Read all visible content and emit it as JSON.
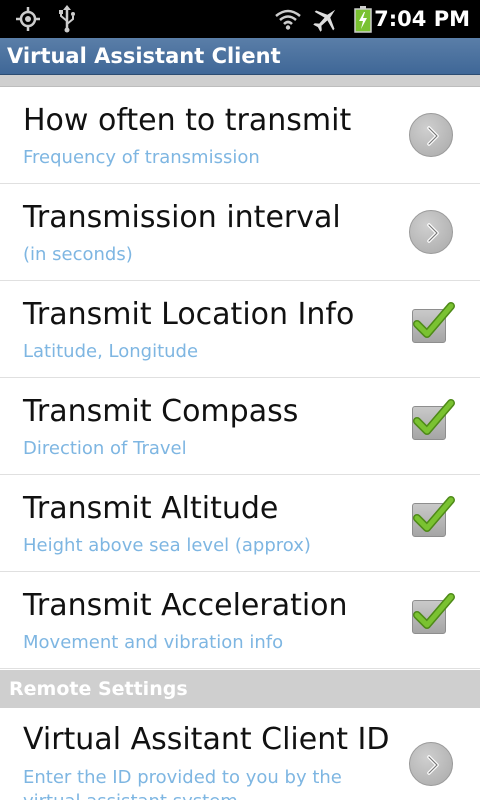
{
  "status_bar": {
    "time": "7:04 PM",
    "icons": [
      "gps-icon",
      "usb-icon",
      "wifi-icon",
      "airplane-icon",
      "battery-charging-icon"
    ]
  },
  "app": {
    "title": "Virtual Assistant Client"
  },
  "preferences": [
    {
      "title": "How often to transmit",
      "summary": "Frequency of transmission",
      "widget": "chevron"
    },
    {
      "title": "Transmission interval",
      "summary": "(in seconds)",
      "widget": "chevron"
    },
    {
      "title": "Transmit Location Info",
      "summary": "Latitude, Longitude",
      "widget": "checkbox",
      "checked": true
    },
    {
      "title": "Transmit Compass",
      "summary": "Direction of Travel",
      "widget": "checkbox",
      "checked": true
    },
    {
      "title": "Transmit Altitude",
      "summary": "Height above sea level (approx)",
      "widget": "checkbox",
      "checked": true
    },
    {
      "title": "Transmit Acceleration",
      "summary": "Movement and vibration info",
      "widget": "checkbox",
      "checked": true
    }
  ],
  "remote_settings": {
    "header": "Remote Settings",
    "item": {
      "title": "Virtual Assitant Client ID",
      "summary": "Enter the ID provided to you by the virtual assistant system",
      "widget": "chevron"
    }
  },
  "colors": {
    "title_bar": "#4a71a0",
    "summary_text": "#7eb6e2",
    "checkmark": "#7ac231",
    "category_bg": "#cfcfcf"
  }
}
